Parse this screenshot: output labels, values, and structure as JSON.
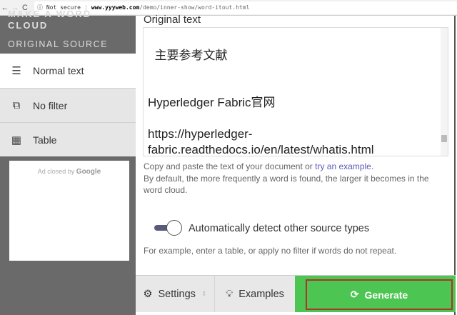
{
  "browser": {
    "security": "Not secure",
    "host": "www.yyyweb.com",
    "path": "/demo/inner-show/word-itout.html"
  },
  "sidebar": {
    "brand": "MAKE A WORD CLOUD",
    "section": "ORIGINAL SOURCE",
    "items": [
      {
        "label": "Normal text",
        "icon": "document-icon",
        "active": true
      },
      {
        "label": "No filter",
        "icon": "copy-icon"
      },
      {
        "label": "Table",
        "icon": "table-icon"
      }
    ],
    "ad": {
      "text": "Ad closed by",
      "brand": "Google"
    }
  },
  "main": {
    "title": "Original text",
    "text": "主要参考文献\n\n\nHyperledger Fabric官网\n\nhttps://hyperledger-\nfabric.readthedocs.io/en/latest/whatis.html",
    "help1": "Copy and paste the text of your document or ",
    "help_link": "try an example",
    "help1_end": ".",
    "help2": "By default, the more frequently a word is found, the larger it becomes in the word cloud.",
    "toggle_label": "Automatically detect other source types",
    "toggle_on": true,
    "example": "For example, enter a table, or apply no filter if words do not repeat."
  },
  "buttons": {
    "settings": "Settings",
    "examples": "Examples",
    "generate": "Generate"
  },
  "colors": {
    "generate": "#4cc552",
    "highlight": "#a8362a",
    "sidebar": "#6a6a6a"
  }
}
